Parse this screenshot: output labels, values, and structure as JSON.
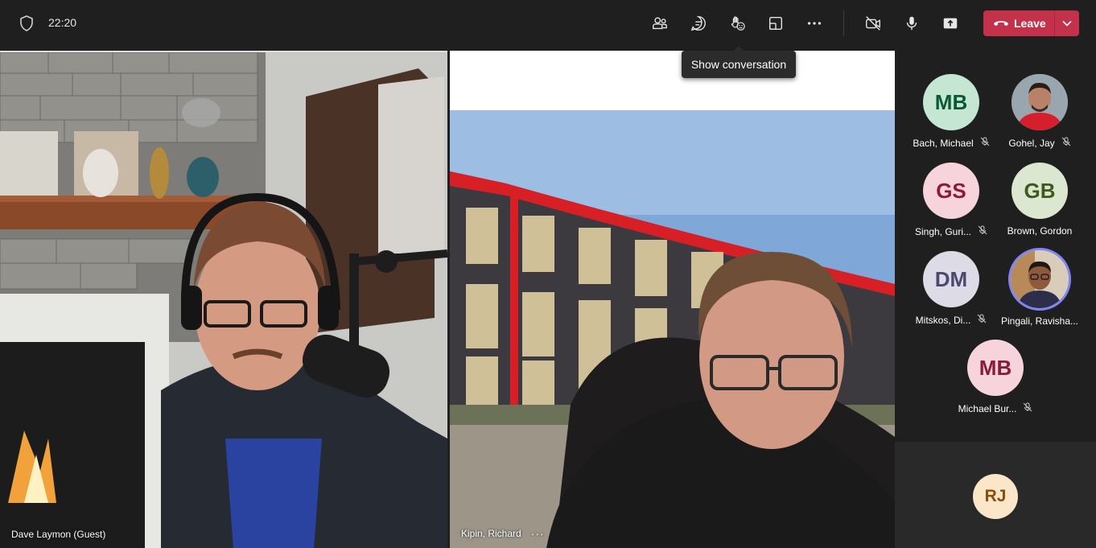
{
  "topbar": {
    "time": "22:20",
    "icons": [
      "people-icon",
      "chat-icon",
      "react-icon",
      "share-tray-icon",
      "more-icon",
      "camera-off-icon",
      "mic-icon",
      "share-icon"
    ],
    "leave_label": "Leave",
    "tooltip": "Show conversation"
  },
  "colors": {
    "leave": "#c4314b",
    "background": "#1f1f1f"
  },
  "tiles": [
    {
      "name": "Dave Laymon (Guest)"
    },
    {
      "name": "Kipin, Richard",
      "more": "···"
    }
  ],
  "participants": [
    {
      "initials": "MB",
      "name": "Bach, Michael",
      "bg": "#c6e6d4",
      "fg": "#0b5a34",
      "muted": true
    },
    {
      "initials": "",
      "name": "Gohel, Jay",
      "photo": true,
      "muted": true
    },
    {
      "initials": "GS",
      "name": "Singh, Guri...",
      "bg": "#f7d4dc",
      "fg": "#8b1a3b",
      "muted": true
    },
    {
      "initials": "GB",
      "name": "Brown, Gordon",
      "bg": "#dce7cf",
      "fg": "#3d5a1c",
      "muted": false
    },
    {
      "initials": "DM",
      "name": "Mitskos, Di...",
      "bg": "#dcdbe6",
      "fg": "#4a4870",
      "muted": true
    },
    {
      "initials": "",
      "name": "Pingali, Ravisha...",
      "photo": true,
      "speaking": true,
      "muted": false
    },
    {
      "initials": "MB",
      "name": "Michael Bur...",
      "bg": "#f7d4dc",
      "fg": "#8b1a3b",
      "muted": true
    }
  ],
  "overflow": {
    "initials": "RJ",
    "bg": "#fce6c9",
    "fg": "#8a4d0b"
  }
}
